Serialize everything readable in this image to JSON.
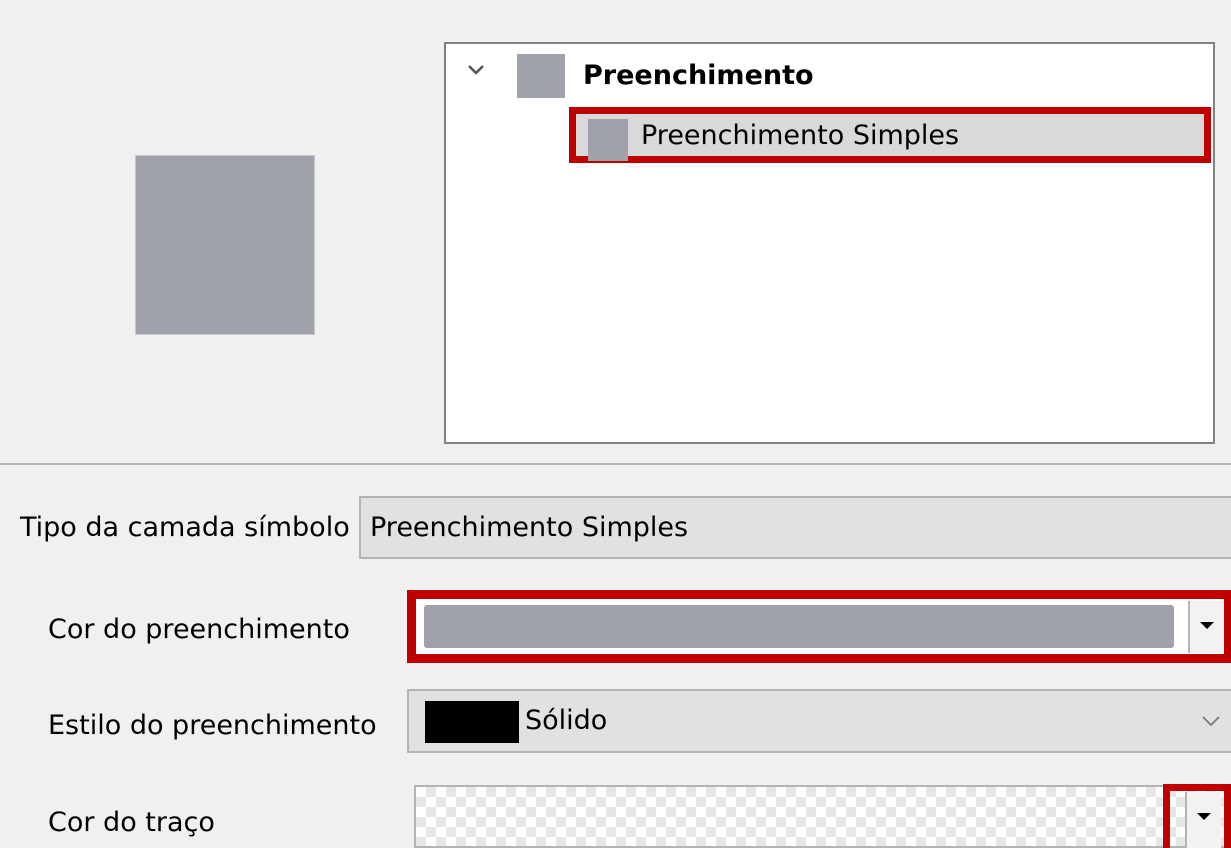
{
  "symbol_tree": {
    "root": {
      "label": "Preenchimento",
      "expander_icon": "chevron-down-icon",
      "swatch_color": "#a0a2ab"
    },
    "child": {
      "label": "Preenchimento Simples",
      "swatch_color": "#a0a2ab",
      "selected": true
    }
  },
  "preview": {
    "fill_color": "#a0a2ab"
  },
  "symbol_layer_type": {
    "label": "Tipo da camada símbolo",
    "value": "Preenchimento Simples"
  },
  "properties": {
    "fill_color": {
      "label": "Cor do preenchimento",
      "value_color": "#a0a2ab",
      "dropdown_icon": "triangle-down-icon"
    },
    "fill_style": {
      "label": "Estilo do preenchimento",
      "value": "Sólido",
      "swatch_color": "#000000",
      "dropdown_icon": "chevron-down-icon"
    },
    "stroke_color": {
      "label": "Cor do traço",
      "value_pattern": "transparent-checkerboard",
      "dropdown_icon": "triangle-down-icon"
    }
  },
  "highlight_color": "#c00000"
}
